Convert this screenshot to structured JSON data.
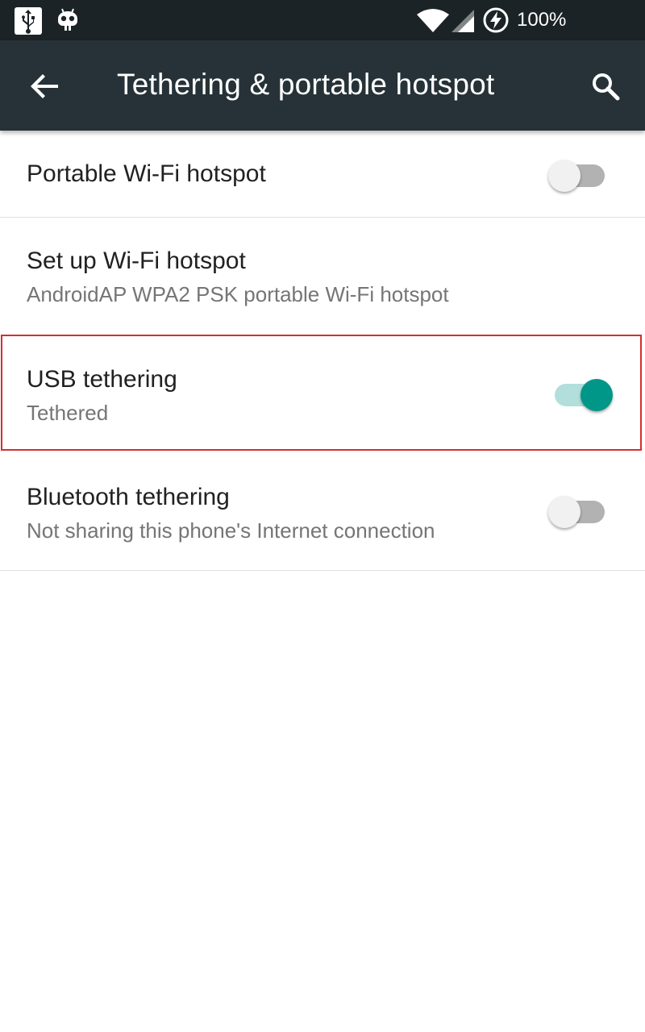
{
  "status_bar": {
    "battery_percent": "100%",
    "icons": [
      "usb-icon",
      "cyanogenmod-bot-icon",
      "wifi-icon",
      "cell-signal-icon",
      "battery-charging-icon"
    ]
  },
  "app_bar": {
    "title": "Tethering & portable hotspot",
    "back_icon": "arrow-back-icon",
    "search_icon": "search-icon",
    "background": "#263238"
  },
  "settings": {
    "portable_wifi": {
      "title": "Portable Wi-Fi hotspot",
      "enabled": false
    },
    "setup_wifi": {
      "title": "Set up Wi-Fi hotspot",
      "summary": "AndroidAP WPA2 PSK portable Wi-Fi hotspot"
    },
    "usb_tethering": {
      "title": "USB tethering",
      "summary": "Tethered",
      "enabled": true
    },
    "bluetooth_tethering": {
      "title": "Bluetooth tethering",
      "summary": "Not sharing this phone's Internet connection",
      "enabled": false
    }
  },
  "colors": {
    "accent": "#009688",
    "accent_track": "#b2dfdb",
    "highlight_border": "#d32f2f"
  }
}
